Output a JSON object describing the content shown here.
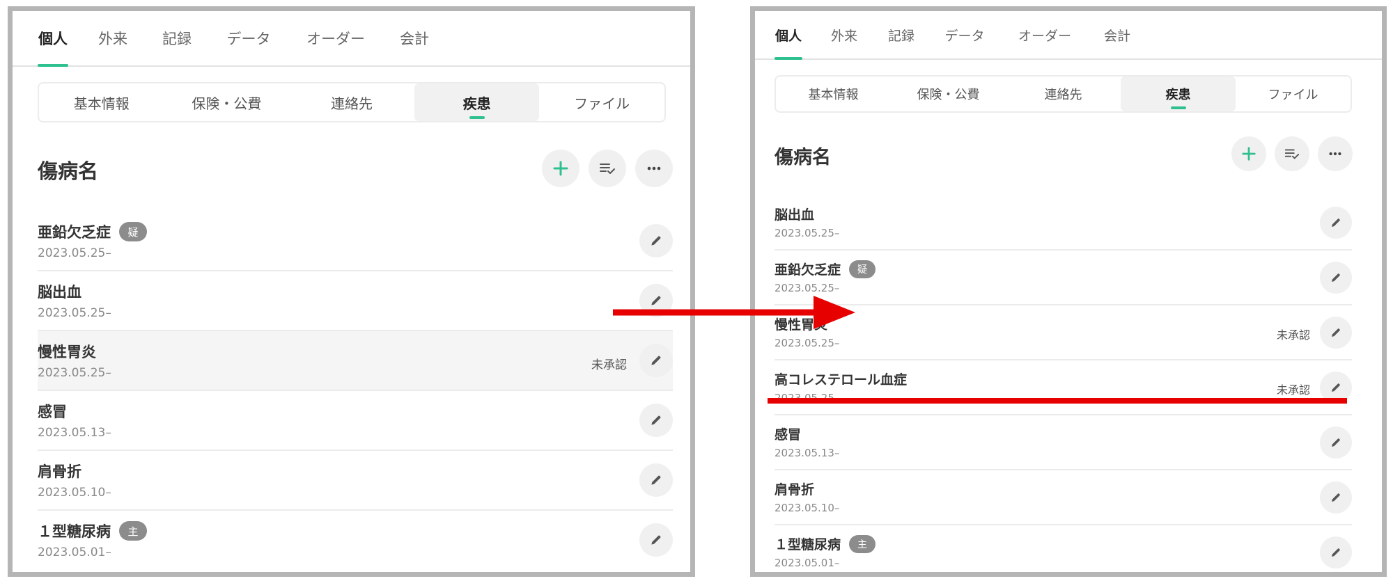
{
  "tabs": [
    "個人",
    "外来",
    "記録",
    "データ",
    "オーダー",
    "会計"
  ],
  "subtabs": [
    "基本情報",
    "保険・公費",
    "連絡先",
    "疾患",
    "ファイル"
  ],
  "section_title": "傷病名",
  "status_unapproved": "未承認",
  "badges": {
    "suspected": "疑",
    "main": "主"
  },
  "before": {
    "rows": [
      {
        "name": "亜鉛欠乏症",
        "badge": "疑",
        "date": "2023.05.25–"
      },
      {
        "name": "脳出血",
        "date": "2023.05.25–"
      },
      {
        "name": "慢性胃炎",
        "date": "2023.05.25–",
        "status": "未承認"
      },
      {
        "name": "感冒",
        "date": "2023.05.13–"
      },
      {
        "name": "肩骨折",
        "date": "2023.05.10–"
      },
      {
        "name": "１型糖尿病",
        "badge": "主",
        "date": "2023.05.01–"
      }
    ]
  },
  "after": {
    "rows": [
      {
        "name": "脳出血",
        "date": "2023.05.25–"
      },
      {
        "name": "亜鉛欠乏症",
        "badge": "疑",
        "date": "2023.05.25–"
      },
      {
        "name": "慢性胃炎",
        "date": "2023.05.25–",
        "status": "未承認"
      },
      {
        "name": "高コレステロール血症",
        "date": "2023.05.25–",
        "status": "未承認"
      },
      {
        "name": "感冒",
        "date": "2023.05.13–"
      },
      {
        "name": "肩骨折",
        "date": "2023.05.10–"
      },
      {
        "name": "１型糖尿病",
        "badge": "主",
        "date": "2023.05.01–"
      }
    ]
  },
  "colors": {
    "accent": "#2fc08f",
    "annotation": "#e60000",
    "panel_border": "#b5b5b5"
  },
  "icons": [
    "plus-icon",
    "sort-check-icon",
    "more-horizontal-icon",
    "pencil-icon"
  ]
}
